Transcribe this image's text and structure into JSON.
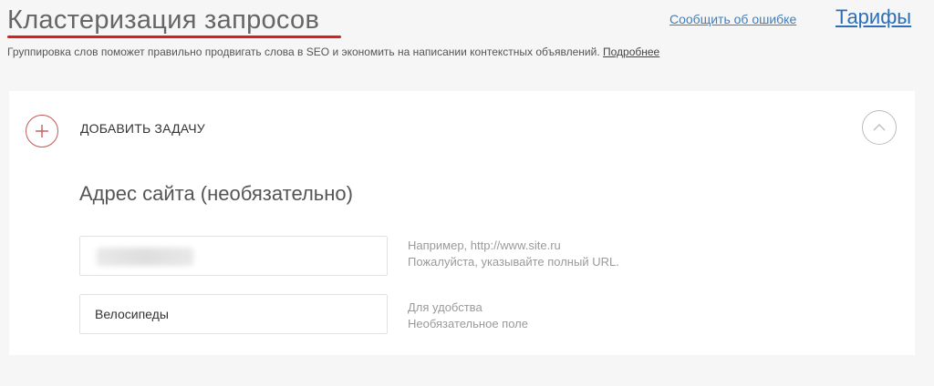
{
  "header": {
    "title": "Кластеризация запросов",
    "report_link": "Сообщить об ошибке",
    "tariffs_link": "Тарифы",
    "subtitle": "Группировка слов поможет правильно продвигать слова в SEO и экономить на написании контекстных объявлений.",
    "more_link": "Подробнее",
    "accent_color": "#d81e1e",
    "link_color": "#2c6fb7"
  },
  "panel": {
    "add_task_label": "ДОБАВИТЬ ЗАДАЧУ",
    "add_icon": "plus-circle-icon",
    "collapse_icon": "chevron-up-circle-icon",
    "section_heading": "Адрес сайта (необязательно)",
    "url_field": {
      "value": "",
      "hint_line1": "Например, http://www.site.ru",
      "hint_line2": "Пожалуйста, указывайте полный URL."
    },
    "name_field": {
      "value": "Велосипеды",
      "hint_line1": "Для удобства",
      "hint_line2": "Необязательное поле"
    }
  }
}
